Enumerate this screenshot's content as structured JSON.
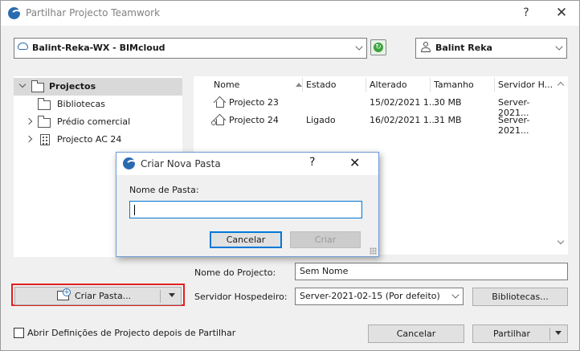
{
  "window": {
    "title": "Partilhar Projecto Teamwork",
    "help_glyph": "?",
    "close_glyph": "✕"
  },
  "toolbar": {
    "server_combo": "Balint-Reka-WX - BIMcloud",
    "user_combo": "Balint Reka"
  },
  "tree": {
    "items": [
      {
        "label": "Projectos"
      },
      {
        "label": "Bibliotecas"
      },
      {
        "label": "Prédio comercial"
      },
      {
        "label": "Projecto AC 24"
      }
    ]
  },
  "list": {
    "columns": [
      "Nome",
      "Estado",
      "Alterado",
      "Tamanho",
      "Servidor H..."
    ],
    "rows": [
      {
        "name": "Projecto 23",
        "status": "",
        "modified": "15/02/2021 1...",
        "size": "30 MB",
        "server": "Server-2021..."
      },
      {
        "name": "Projecto 24",
        "status": "Ligado",
        "modified": "16/02/2021 1...",
        "size": "31 MB",
        "server": "Server-2021..."
      }
    ]
  },
  "create_folder_button": "Criar Pasta...",
  "form": {
    "project_name_label": "Nome do Projecto:",
    "project_name_value": "Sem Nome",
    "host_server_label": "Servidor Hospedeiro:",
    "host_server_value": "Server-2021-02-15 (Por defeito)",
    "libraries_button": "Bibliotecas..."
  },
  "footer": {
    "checkbox_label": "Abrir Definições de Projecto depois de Partilhar",
    "cancel_button": "Cancelar",
    "share_button": "Partilhar"
  },
  "dialog": {
    "title": "Criar Nova Pasta",
    "help_glyph": "?",
    "close_glyph": "✕",
    "field_label": "Nome de Pasta:",
    "field_value": "",
    "cancel_button": "Cancelar",
    "create_button": "Criar"
  },
  "colors": {
    "accent": "#0078d7",
    "highlight": "#e02020",
    "sync": "#3ca33c"
  }
}
